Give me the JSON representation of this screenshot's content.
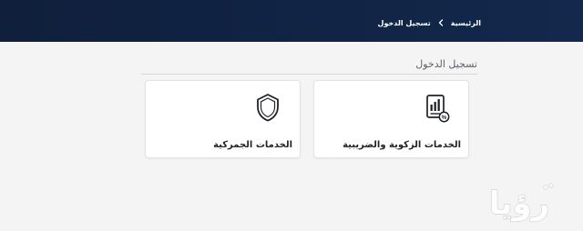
{
  "header": {
    "breadcrumb": {
      "home": "الرئيسية",
      "current": "تسجيل الدخول"
    }
  },
  "main": {
    "section_title": "تسجيل الدخول",
    "cards": [
      {
        "label": "الخدمات الزكوية والضريبية",
        "icon": "document-chart-percent-icon"
      },
      {
        "label": "الخدمات الجمركية",
        "icon": "shield-icon"
      }
    ]
  },
  "watermark": {
    "text": "رؤيا"
  },
  "colors": {
    "header_background": "#13284c",
    "page_background": "#f4f4f4",
    "card_background": "#ffffff",
    "text_primary": "#1f2328",
    "text_secondary": "#5e6368"
  }
}
